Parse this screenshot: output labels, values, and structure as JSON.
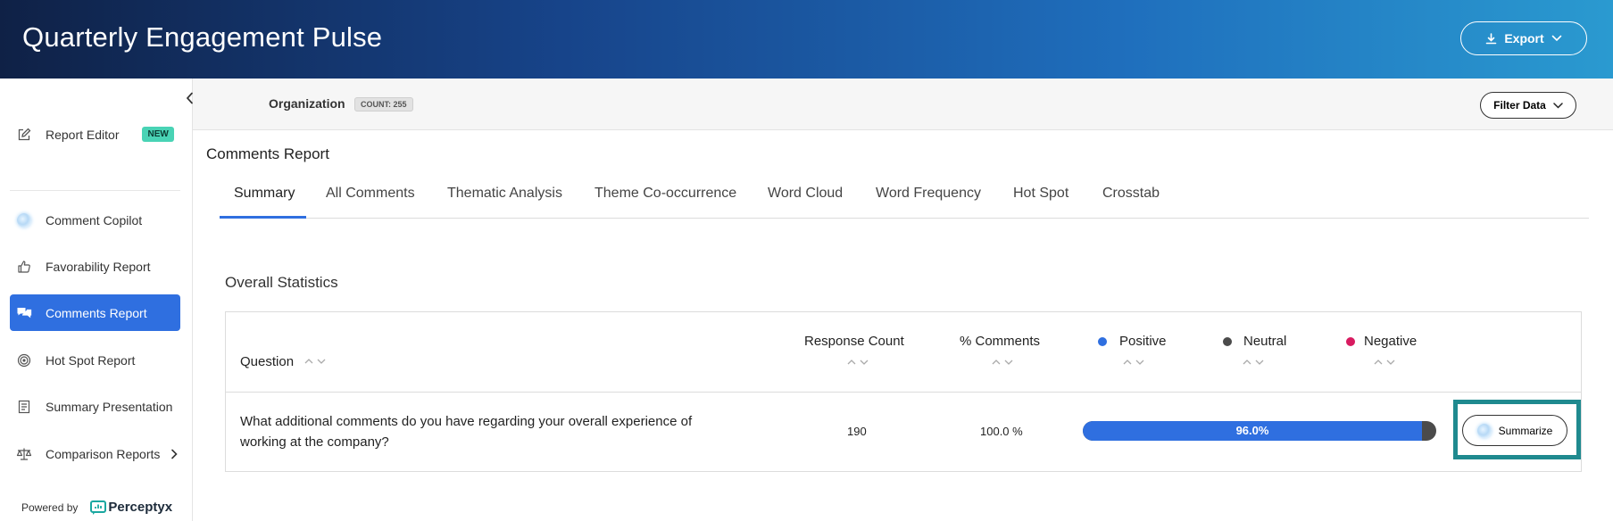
{
  "header": {
    "title": "Quarterly Engagement Pulse",
    "export_label": "Export"
  },
  "sidebar": {
    "items": [
      {
        "label": "Report Editor",
        "badge": "NEW",
        "icon": "edit-icon"
      },
      {
        "label": "Comment Copilot",
        "icon": "copilot-spark-icon"
      },
      {
        "label": "Favorability Report",
        "icon": "thumbs-up-icon"
      },
      {
        "label": "Comments Report",
        "icon": "chat-bubbles-icon",
        "active": true
      },
      {
        "label": "Hot Spot Report",
        "icon": "target-icon"
      },
      {
        "label": "Summary Presentation",
        "icon": "document-icon"
      },
      {
        "label": "Comparison Reports",
        "icon": "scale-icon"
      }
    ],
    "powered_by": "Powered by",
    "brand": "Perceptyx"
  },
  "filterbar": {
    "organization_label": "Organization",
    "count_badge": "COUNT: 255",
    "filter_label": "Filter Data"
  },
  "report": {
    "title": "Comments Report",
    "tabs": [
      {
        "label": "Summary",
        "active": true
      },
      {
        "label": "All Comments"
      },
      {
        "label": "Thematic Analysis"
      },
      {
        "label": "Theme Co-occurrence"
      },
      {
        "label": "Word Cloud"
      },
      {
        "label": "Word Frequency"
      },
      {
        "label": "Hot Spot"
      },
      {
        "label": "Crosstab"
      }
    ]
  },
  "stats": {
    "title": "Overall Statistics",
    "columns": {
      "question": "Question",
      "response_count": "Response Count",
      "pct_comments": "% Comments",
      "positive": "Positive",
      "neutral": "Neutral",
      "negative": "Negative"
    },
    "row": {
      "question": "What additional comments do you have regarding your overall experience of working at the company?",
      "response_count": "190",
      "pct_comments": "100.0 %",
      "positive_pct": 96.0,
      "positive_label": "96.0%",
      "summarize_label": "Summarize"
    },
    "colors": {
      "positive": "#2f6fe0",
      "neutral": "#4b4b4b",
      "negative": "#d81b60",
      "accent": "#2f6fe0",
      "highlight_frame": "#1f8a8f"
    }
  }
}
